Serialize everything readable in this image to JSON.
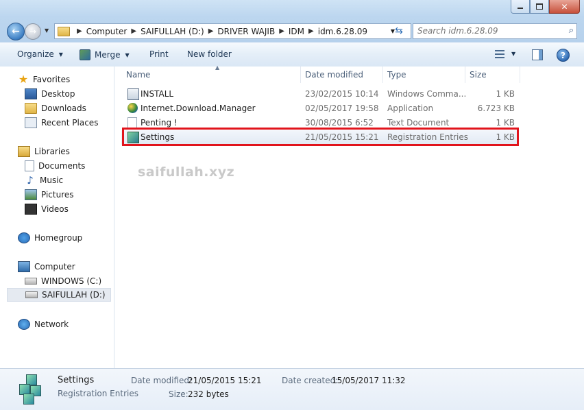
{
  "window": {
    "close_glyph": "✕"
  },
  "address": {
    "crumbs": [
      "Computer",
      "SAIFULLAH (D:)",
      "DRIVER WAJIB",
      "IDM",
      "idm.6.28.09"
    ]
  },
  "search": {
    "placeholder": "Search idm.6.28.09"
  },
  "toolbar": {
    "organize": "Organize",
    "merge": "Merge",
    "print": "Print",
    "new_folder": "New folder"
  },
  "sidebar": {
    "favorites": "Favorites",
    "desktop": "Desktop",
    "downloads": "Downloads",
    "recent_places": "Recent Places",
    "libraries": "Libraries",
    "documents": "Documents",
    "music": "Music",
    "pictures": "Pictures",
    "videos": "Videos",
    "homegroup": "Homegroup",
    "computer": "Computer",
    "drive_c": "WINDOWS (C:)",
    "drive_d": "SAIFULLAH (D:)",
    "network": "Network"
  },
  "columns": {
    "name": "Name",
    "date_modified": "Date modified",
    "type": "Type",
    "size": "Size"
  },
  "files": [
    {
      "name": "INSTALL",
      "date": "23/02/2015 10:14",
      "type": "Windows Comma...",
      "size": "1 KB",
      "icon": "cmd-icon"
    },
    {
      "name": "Internet.Download.Manager",
      "date": "02/05/2017 19:58",
      "type": "Application",
      "size": "6.723 KB",
      "icon": "app-icon"
    },
    {
      "name": "Penting !",
      "date": "30/08/2015 6:52",
      "type": "Text Document",
      "size": "1 KB",
      "icon": "text-doc-icon"
    },
    {
      "name": "Settings",
      "date": "21/05/2015 15:21",
      "type": "Registration Entries",
      "size": "1 KB",
      "icon": "registry-icon"
    }
  ],
  "watermark": "saifullah.xyz",
  "details": {
    "name": "Settings",
    "type": "Registration Entries",
    "date_modified_label": "Date modified:",
    "date_modified": "21/05/2015 15:21",
    "size_label": "Size:",
    "size": "232 bytes",
    "date_created_label": "Date created:",
    "date_created": "15/05/2017 11:32"
  }
}
